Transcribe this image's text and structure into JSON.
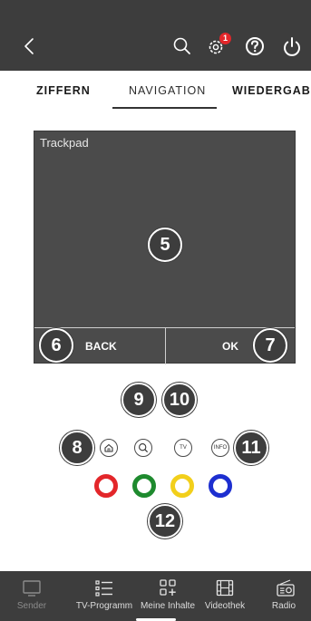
{
  "header": {
    "settings_badge_count": "1",
    "icons": [
      "back-icon",
      "search-icon",
      "settings-icon",
      "help-icon",
      "power-icon"
    ]
  },
  "tabs": [
    {
      "label": "ZIFFERN",
      "active": false
    },
    {
      "label": "NAVIGATION",
      "active": true
    },
    {
      "label": "WIEDERGABE",
      "active": false
    }
  ],
  "trackpad": {
    "label": "Trackpad",
    "back_label": "BACK",
    "ok_label": "OK"
  },
  "annotations": [
    "5",
    "6",
    "7",
    "8",
    "9",
    "10",
    "11",
    "12"
  ],
  "remote_buttons": {
    "tv_label": "TV",
    "info_label": "INFO"
  },
  "color_buttons": [
    "#e3262a",
    "#1e8a2e",
    "#f2cf1b",
    "#1d2fd0"
  ],
  "bottom_nav": [
    {
      "label": "Sender",
      "icon": "tv-monitor-icon",
      "enabled": false
    },
    {
      "label": "TV-Programm",
      "icon": "list-icon",
      "enabled": true
    },
    {
      "label": "Meine Inhalte",
      "icon": "grid-plus-icon",
      "enabled": true
    },
    {
      "label": "Videothek",
      "icon": "film-icon",
      "enabled": true
    },
    {
      "label": "Radio",
      "icon": "radio-icon",
      "enabled": true
    }
  ],
  "colors": {
    "bar": "#3d3d3d",
    "trackpad": "#4b4b4b",
    "badge_red": "#e3262a"
  }
}
